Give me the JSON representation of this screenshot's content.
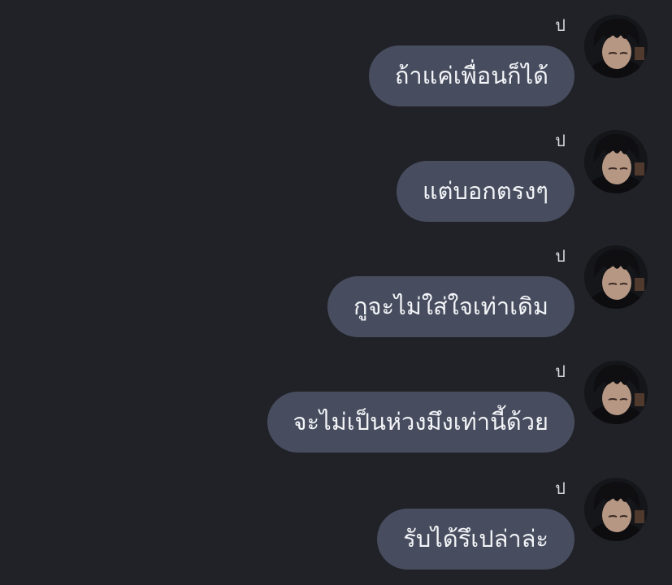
{
  "messages": [
    {
      "sender": "ป",
      "text": "ถ้าแค่เพื่อนก็ได้"
    },
    {
      "sender": "ป",
      "text": "แต่บอกตรงๆ"
    },
    {
      "sender": "ป",
      "text": "กูจะไม่ใส่ใจเท่าเดิม"
    },
    {
      "sender": "ป",
      "text": "จะไม่เป็นห่วงมึงเท่านี้ด้วย"
    },
    {
      "sender": "ป",
      "text": "รับได้รึเปล่าล่ะ"
    }
  ],
  "colors": {
    "background": "#212227",
    "bubble": "#474d5f",
    "text": "#f3f4f7"
  },
  "icons": {
    "avatar": "profile-photo-avatar"
  }
}
